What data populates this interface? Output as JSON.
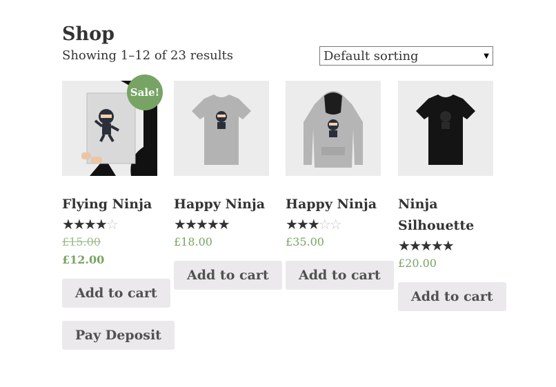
{
  "page": {
    "title": "Shop",
    "result_count": "Showing 1–12 of 23 results"
  },
  "sorting": {
    "selected": "Default sorting"
  },
  "colors": {
    "accent": "#77a464",
    "button_bg": "#ebe9eb",
    "button_text": "#515151"
  },
  "products": [
    {
      "title": "Flying Ninja",
      "rating": 4,
      "old_price": "£15.00",
      "price": "£12.00",
      "sale_badge": "Sale!",
      "add_to_cart": "Add to cart",
      "deposit": "Pay Deposit"
    },
    {
      "title": "Happy Ninja",
      "rating": 5,
      "price": "£18.00",
      "add_to_cart": "Add to cart"
    },
    {
      "title": "Happy Ninja",
      "rating": 3,
      "price": "£35.00",
      "add_to_cart": "Add to cart"
    },
    {
      "title": "Ninja Silhouette",
      "rating": 5,
      "price": "£20.00",
      "add_to_cart": "Add to cart"
    }
  ]
}
